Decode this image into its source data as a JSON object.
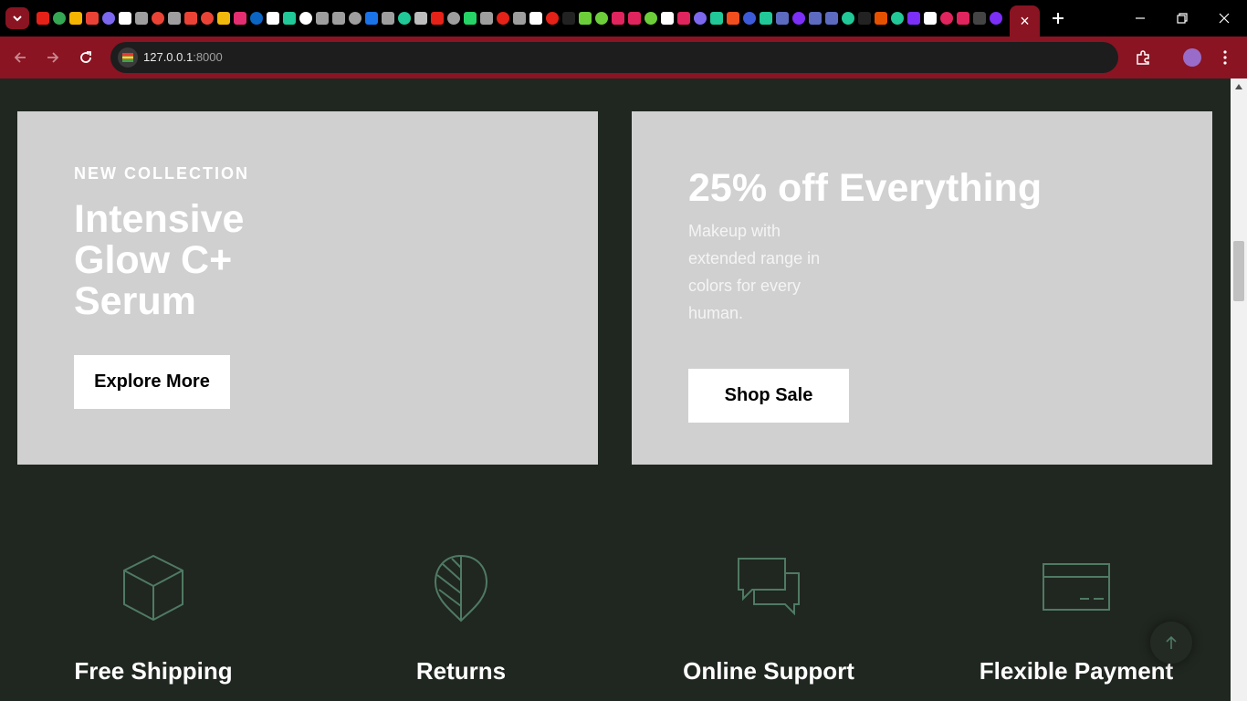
{
  "browser": {
    "url_host": "127.0.0.1",
    "url_port": ":8000",
    "active_tab_close": "×",
    "colors": {
      "frame": "#8a1422",
      "tabstrip": "#000000"
    },
    "favicon_colors": [
      "#e62117",
      "#34a853",
      "#f4b400",
      "#ea4335",
      "#7b68ee",
      "#ffffff",
      "#9e9e9e",
      "#ea4335",
      "#9e9e9e",
      "#ea4335",
      "#ea4335",
      "#f0b90b",
      "#e52e71",
      "#0a66c2",
      "#ffffff",
      "#20c997",
      "#ffffff",
      "#9e9e9e",
      "#9e9e9e",
      "#9e9e9e",
      "#1a73e8",
      "#9e9e9e",
      "#20c997",
      "#bdbdbd",
      "#e62117",
      "#9e9e9e",
      "#25d366",
      "#9e9e9e",
      "#e62117",
      "#9e9e9e",
      "#ffffff",
      "#e62117",
      "#222222",
      "#6ccf3a",
      "#6ccf3a",
      "#e0245e",
      "#e0245e",
      "#6ccf3a",
      "#ffffff",
      "#e0245e",
      "#7b68ee",
      "#20c997",
      "#f24e1e",
      "#3b5bdb",
      "#20c997",
      "#5c6bc0",
      "#7b2ff7",
      "#5c6bc0",
      "#5c6bc0",
      "#20c997",
      "#222222",
      "#e65100",
      "#20c997",
      "#7b2ff7",
      "#ffffff",
      "#e0245e",
      "#e0245e",
      "#444444",
      "#7b2ff7"
    ]
  },
  "banners": {
    "left": {
      "eyebrow": "NEW COLLECTION",
      "title": "Intensive Glow C+ Serum",
      "button": "Explore More"
    },
    "right": {
      "title": "25% off Everything",
      "description": "Makeup with extended range in colors for every human.",
      "button": "Shop Sale"
    }
  },
  "features": [
    {
      "icon": "box-icon",
      "label": "Free Shipping"
    },
    {
      "icon": "leaf-icon",
      "label": "Returns"
    },
    {
      "icon": "chat-icon",
      "label": "Online Support"
    },
    {
      "icon": "credit-card-icon",
      "label": "Flexible Payment"
    }
  ],
  "colors": {
    "page_bg": "#202620",
    "banner_bg": "#d0d0d0",
    "icon_stroke": "#4f7a63"
  }
}
